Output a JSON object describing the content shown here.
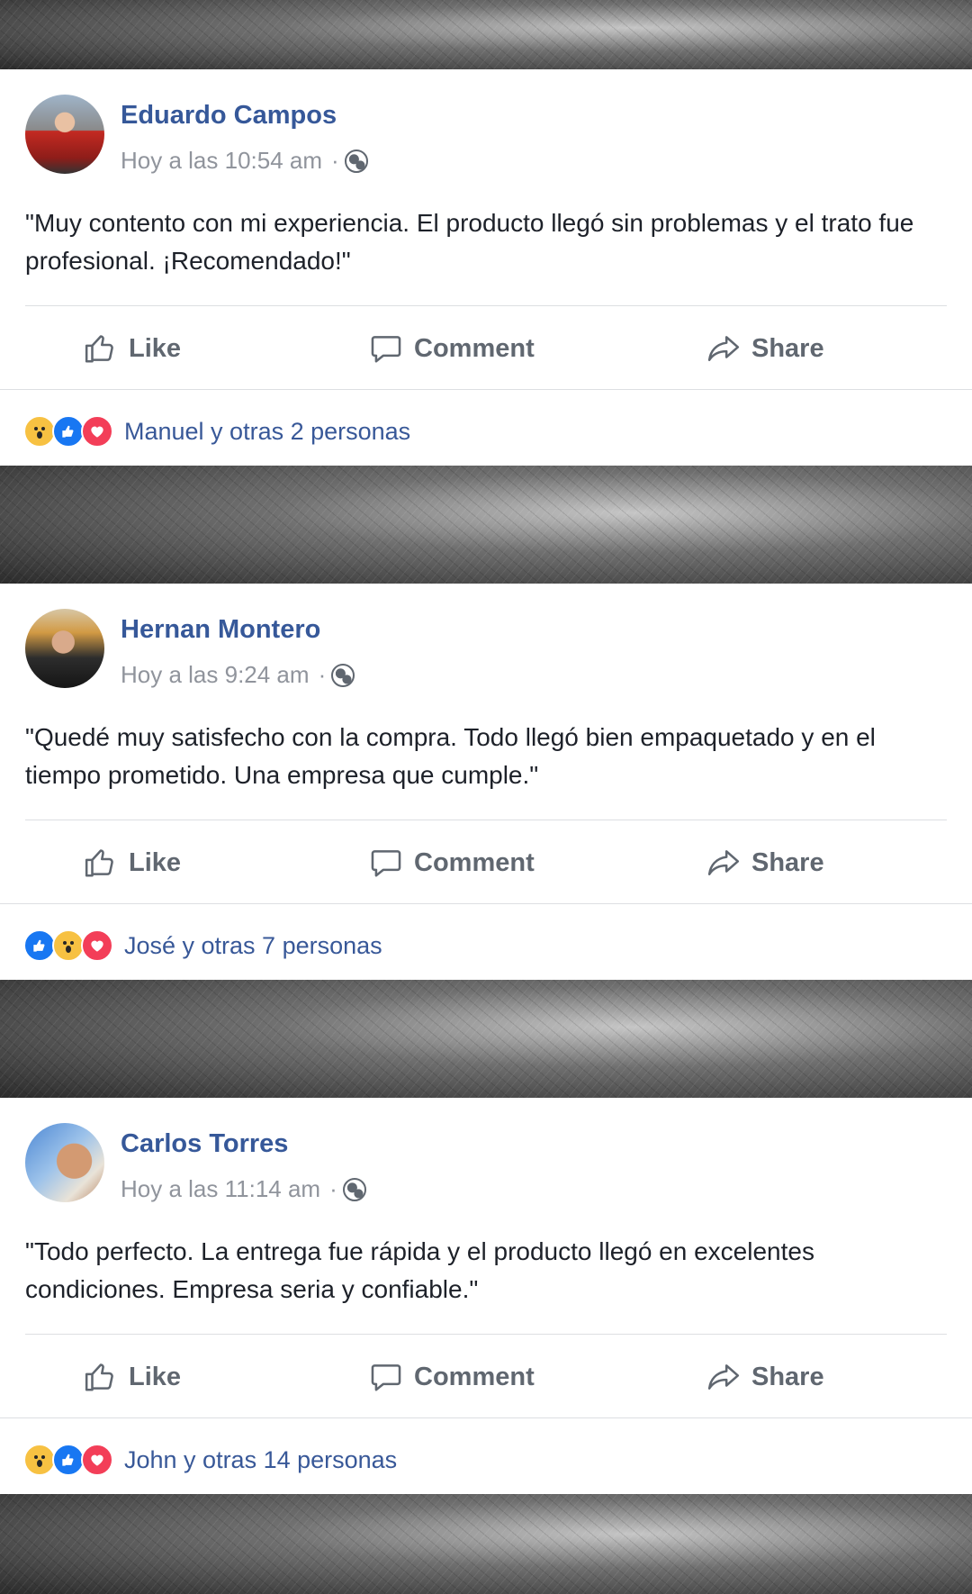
{
  "posts": [
    {
      "author": "Eduardo Campos",
      "time": "Hoy a las 10:54 am",
      "dot": "·",
      "text": "\"Muy contento con mi experiencia. El producto llegó sin problemas y el trato fue profesional. ¡Recomendado!\"",
      "actions": {
        "like": "Like",
        "comment": "Comment",
        "share": "Share"
      },
      "reactions": [
        "wow",
        "like",
        "love"
      ],
      "reaction_summary": "Manuel y otras 2 personas"
    },
    {
      "author": "Hernan Montero",
      "time": "Hoy a las 9:24 am",
      "dot": "·",
      "text": "\"Quedé muy satisfecho con la compra. Todo llegó bien empaquetado y en el tiempo prometido. Una empresa que cumple.\"",
      "actions": {
        "like": "Like",
        "comment": "Comment",
        "share": "Share"
      },
      "reactions": [
        "like",
        "wow",
        "love"
      ],
      "reaction_summary": "José y otras 7 personas"
    },
    {
      "author": "Carlos Torres",
      "time": "Hoy a las 11:14 am",
      "dot": "·",
      "text": "\"Todo perfecto. La entrega fue rápida y el producto llegó en excelentes condiciones. Empresa seria y confiable.\"",
      "actions": {
        "like": "Like",
        "comment": "Comment",
        "share": "Share"
      },
      "reactions": [
        "wow",
        "like",
        "love"
      ],
      "reaction_summary": "John y otras 14 personas"
    }
  ],
  "colors": {
    "author_name": "#365899",
    "meta_text": "#90949c",
    "body_text": "#1d2129",
    "action_text": "#606770",
    "reaction_link": "#385898"
  }
}
